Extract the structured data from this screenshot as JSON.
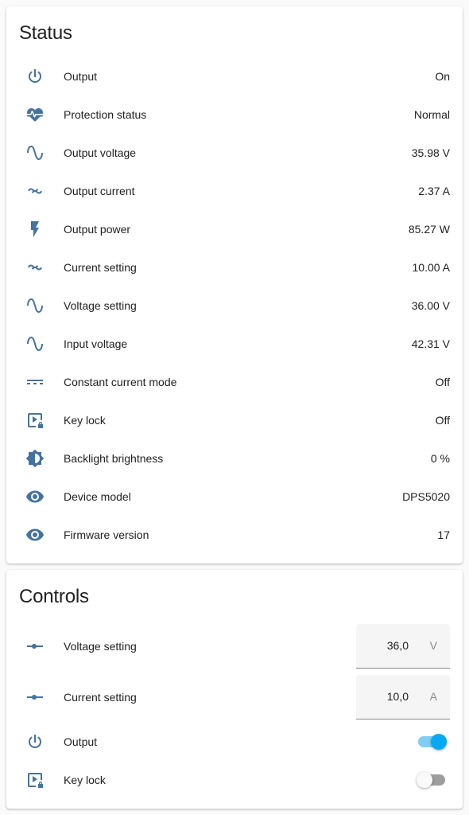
{
  "status": {
    "title": "Status",
    "rows": [
      {
        "label": "Output",
        "value": "On",
        "icon": "power-icon"
      },
      {
        "label": "Protection status",
        "value": "Normal",
        "icon": "heart-pulse-icon"
      },
      {
        "label": "Output voltage",
        "value": "35.98 V",
        "icon": "sine-wave-icon"
      },
      {
        "label": "Output current",
        "value": "2.37 A",
        "icon": "current-ac-icon"
      },
      {
        "label": "Output power",
        "value": "85.27 W",
        "icon": "flash-icon"
      },
      {
        "label": "Current setting",
        "value": "10.00 A",
        "icon": "current-ac-icon"
      },
      {
        "label": "Voltage setting",
        "value": "36.00 V",
        "icon": "sine-wave-icon"
      },
      {
        "label": "Input voltage",
        "value": "42.31 V",
        "icon": "sine-wave-icon"
      },
      {
        "label": "Constant current mode",
        "value": "Off",
        "icon": "current-dc-icon"
      },
      {
        "label": "Key lock",
        "value": "Off",
        "icon": "play-box-lock-icon"
      },
      {
        "label": "Backlight brightness",
        "value": "0 %",
        "icon": "brightness-icon"
      },
      {
        "label": "Device model",
        "value": "DPS5020",
        "icon": "eye-icon"
      },
      {
        "label": "Firmware version",
        "value": "17",
        "icon": "eye-icon"
      }
    ]
  },
  "controls": {
    "title": "Controls",
    "voltage": {
      "label": "Voltage setting",
      "value": "36,0",
      "unit": "V",
      "icon": "slider-icon"
    },
    "current": {
      "label": "Current setting",
      "value": "10,0",
      "unit": "A",
      "icon": "slider-icon"
    },
    "output": {
      "label": "Output",
      "state": "on",
      "icon": "power-icon"
    },
    "keylock": {
      "label": "Key lock",
      "state": "off",
      "icon": "play-box-lock-icon"
    }
  },
  "colors": {
    "icon": "#44739e",
    "toggle_on": "#03a9f4",
    "toggle_track_on": "#7fcff3",
    "toggle_off": "#9e9e9e"
  }
}
